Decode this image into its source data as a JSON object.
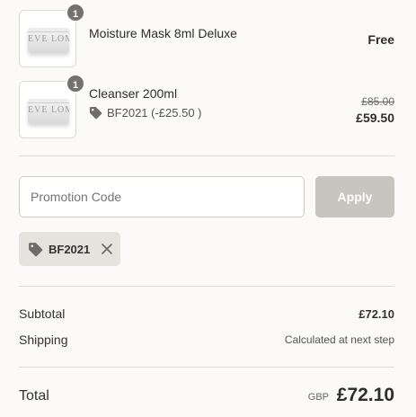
{
  "items": [
    {
      "name": "Moisture Mask 8ml Deluxe",
      "quantity": "1",
      "thumb_brand": "EVE LOM",
      "price": "Free"
    },
    {
      "name": "Cleanser 200ml",
      "quantity": "1",
      "thumb_brand": "EVE LOM",
      "discount": "BF2021 (-£25.50 )",
      "original_price": "£85.00",
      "price": "£59.50"
    }
  ],
  "promo": {
    "placeholder": "Promotion Code",
    "apply_label": "Apply"
  },
  "applied_code": {
    "code": "BF2021"
  },
  "summary": {
    "subtotal_label": "Subtotal",
    "subtotal_value": "£72.10",
    "shipping_label": "Shipping",
    "shipping_value": "Calculated at next step",
    "total_label": "Total",
    "total_currency": "GBP",
    "total_value": "£72.10"
  },
  "colors": {
    "background": "#fbfaf8",
    "badge": "#747270",
    "apply_disabled": "#c8c5c0",
    "chip_bg": "#e6e3df",
    "tag_icon": "#6f6d6b"
  },
  "icons": [
    "tag-icon",
    "close-icon"
  ]
}
